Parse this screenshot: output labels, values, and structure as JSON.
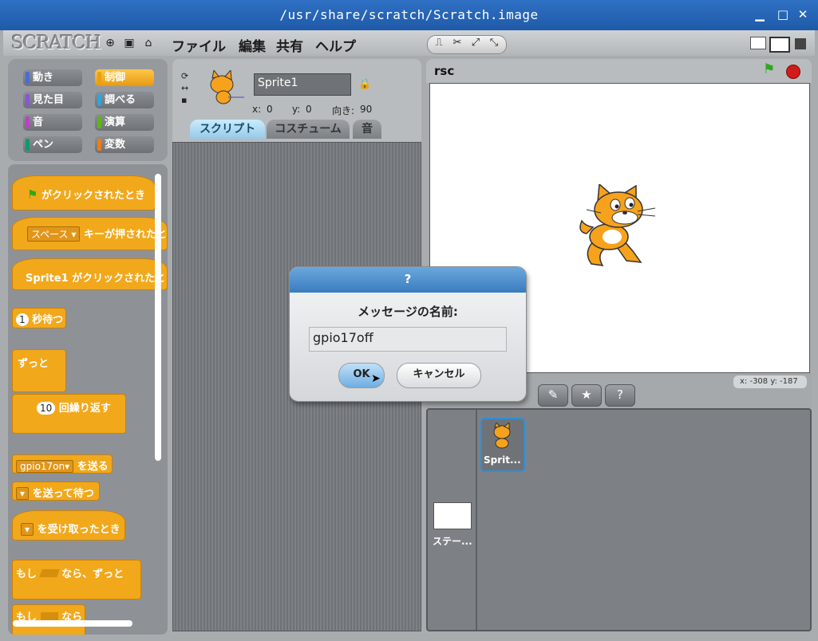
{
  "window": {
    "title": "/usr/share/scratch/Scratch.image"
  },
  "menubar": {
    "logo": "SCRATCH",
    "menus": [
      "ファイル",
      "編集",
      "共有",
      "ヘルプ"
    ]
  },
  "categories": [
    {
      "label": "動き",
      "color": "#4a6cd4"
    },
    {
      "label": "制御",
      "color": "#e6a117",
      "selected": true
    },
    {
      "label": "見た目",
      "color": "#8a55d7"
    },
    {
      "label": "調べる",
      "color": "#2ca5e2"
    },
    {
      "label": "音",
      "color": "#bb42c3"
    },
    {
      "label": "演算",
      "color": "#5cb712"
    },
    {
      "label": "ペン",
      "color": "#0e9a6c"
    },
    {
      "label": "変数",
      "color": "#ee7d16"
    }
  ],
  "blocks": {
    "flag_clicked": "がクリックされたとき",
    "key_dropdown": "スペース",
    "key_pressed": "キーが押されたと",
    "sprite_clicked": "Sprite1 がクリックされたと",
    "wait_num": "1",
    "wait": "秒待つ",
    "forever": "ずっと",
    "repeat_num": "10",
    "repeat": "回繰り返す",
    "broadcast_dropdown": "gpio17on",
    "broadcast": "を送る",
    "broadcast_wait": "を送って待つ",
    "when_receive": "を受け取ったとき",
    "forever_if_a": "もし",
    "forever_if_b": "なら、ずっと",
    "if_a": "もし",
    "if_b": "なら"
  },
  "sprite": {
    "name": "Sprite1",
    "x_label": "x:",
    "x": "0",
    "y_label": "y:",
    "y": "0",
    "dir_label": "向き:",
    "direction": "90"
  },
  "tabs": [
    "スクリプト",
    "コスチューム",
    "音"
  ],
  "stage": {
    "title": "rsc",
    "coords": "x: -308   y: -187",
    "colors": {
      "flag": "#2ea81c",
      "stop": "#d21a1a"
    }
  },
  "sprites": [
    {
      "label": "Sprit..."
    },
    {
      "label": "ステー..."
    }
  ],
  "dialog": {
    "title": "?",
    "prompt": "メッセージの名前:",
    "value": "gpio17off",
    "ok": "OK",
    "cancel": "キャンセル"
  }
}
